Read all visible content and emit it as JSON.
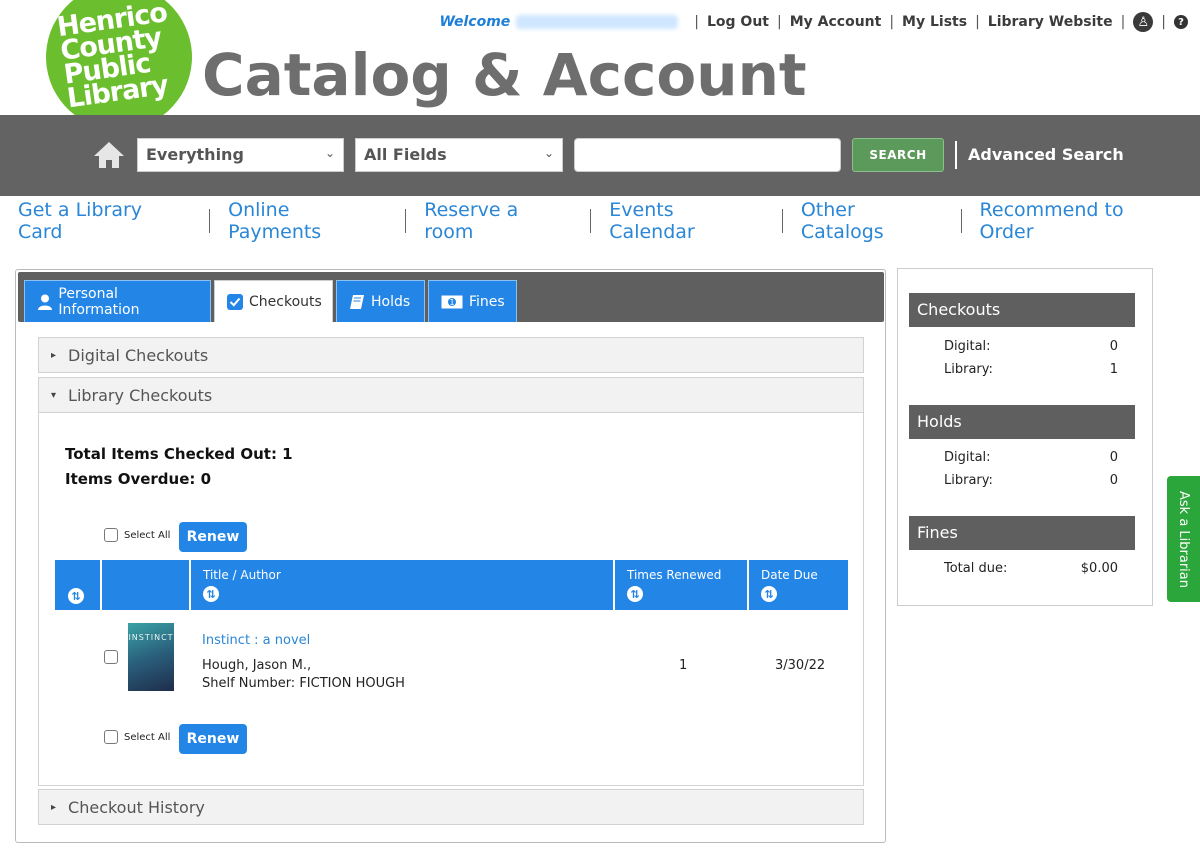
{
  "logo": {
    "line1": "Henrico",
    "line2": "County",
    "line3": "Public",
    "line4": "Library"
  },
  "site_title": "Catalog & Account",
  "topnav": {
    "welcome": "Welcome",
    "logout": "Log Out",
    "my_account": "My Account",
    "my_lists": "My Lists",
    "library_website": "Library Website",
    "accessibility_icon": "accessibility-icon",
    "help_icon": "help-icon"
  },
  "search": {
    "scope": "Everything",
    "field": "All Fields",
    "input_value": "",
    "button": "SEARCH",
    "advanced": "Advanced Search"
  },
  "links": [
    "Get a Library Card",
    "Online Payments",
    "Reserve a room",
    "Events Calendar",
    "Other Catalogs",
    "Recommend to Order"
  ],
  "tabs": [
    {
      "label": "Personal Information",
      "icon": "person-icon"
    },
    {
      "label": "Checkouts",
      "icon": "checkbox-icon"
    },
    {
      "label": "Holds",
      "icon": "book-icon"
    },
    {
      "label": "Fines",
      "icon": "money-icon"
    }
  ],
  "accordions": {
    "digital": "Digital Checkouts",
    "library": "Library Checkouts",
    "history": "Checkout History"
  },
  "summary": {
    "total_label": "Total Items Checked Out: 1",
    "overdue_label": "Items Overdue: 0"
  },
  "select_all": "Select All",
  "renew": "Renew",
  "table": {
    "headers": {
      "title_author": "Title / Author",
      "times_renewed": "Times Renewed",
      "date_due": "Date Due"
    },
    "rows": [
      {
        "title": "Instinct : a novel",
        "author": "Hough, Jason M.,",
        "shelf": "Shelf Number: FICTION HOUGH",
        "times_renewed": "1",
        "date_due": "3/30/22",
        "cover_text": "INSTINCT"
      }
    ]
  },
  "sidebar": {
    "checkouts": {
      "title": "Checkouts",
      "digital_label": "Digital:",
      "digital_value": "0",
      "library_label": "Library:",
      "library_value": "1"
    },
    "holds": {
      "title": "Holds",
      "digital_label": "Digital:",
      "digital_value": "0",
      "library_label": "Library:",
      "library_value": "0"
    },
    "fines": {
      "title": "Fines",
      "total_label": "Total due:",
      "total_value": "$0.00"
    }
  },
  "ask_librarian": "Ask a Librarian",
  "colors": {
    "accent_blue": "#2386e6",
    "link_blue": "#2a86d6",
    "header_gray": "#636363",
    "logo_green": "#6bbf2e",
    "ask_green": "#2aa63a"
  }
}
